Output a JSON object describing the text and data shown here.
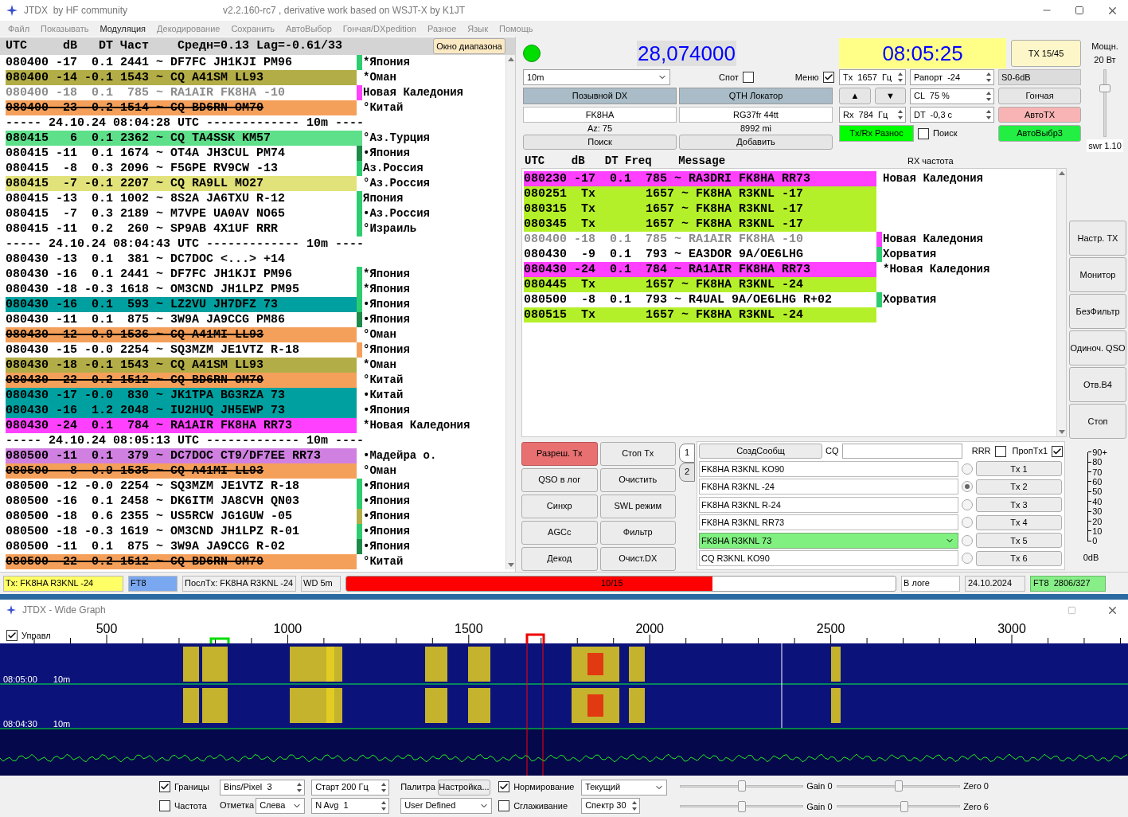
{
  "window": {
    "title": "JTDX  by HF community",
    "version": "v2.2.160-rc7 , derivative work based on WSJT-X by K1JT"
  },
  "menu": [
    {
      "label": "Файл",
      "selected": false
    },
    {
      "label": "Показывать",
      "selected": false
    },
    {
      "label": "Модуляция",
      "selected": true
    },
    {
      "label": "Декодирование",
      "selected": false
    },
    {
      "label": "Сохранить",
      "selected": false
    },
    {
      "label": "АвтоВыбор",
      "selected": false
    },
    {
      "label": "Гончая/DXpedition",
      "selected": false
    },
    {
      "label": "Разное",
      "selected": false
    },
    {
      "label": "Язык",
      "selected": false
    },
    {
      "label": "Помощь",
      "selected": false
    }
  ],
  "band_activity": {
    "header": "UTC     dB   DT Част    Средн=0.13 Lag=-0.61/33",
    "band_window_button": "Окно диапазона",
    "rows": [
      {
        "kind": "decode",
        "text": "080400 -17  0.1 2441 ~ DF7FC JH1KJI PM96",
        "color": "#ffffff",
        "faded": false,
        "struck": false,
        "country": {
          "name": "*Япония",
          "color": "#2ecc71"
        }
      },
      {
        "kind": "decode",
        "text": "080400 -14 -0.1 1543 ~ CQ A41SM LL93",
        "color": "#b3ad47",
        "faded": false,
        "struck": false,
        "country": {
          "name": "*Оман"
        }
      },
      {
        "kind": "decode",
        "text": "080400 -18  0.1  785 ~ RA1AIR FK8HA -10",
        "color": "#ffffff",
        "faded": true,
        "struck": false,
        "country": {
          "name": "Новая Каледония",
          "color": "#ff40ff"
        }
      },
      {
        "kind": "decode",
        "text": "080400 -23  0.2 1514 ~ CQ BD6RN OM70",
        "color": "#f5a05a",
        "faded": false,
        "struck": true,
        "country": {
          "name": "°Китай"
        }
      },
      {
        "kind": "separator",
        "text": "----- 24.10.24 08:04:28 UTC ------------- 10m ----"
      },
      {
        "kind": "decode",
        "text": "080415   6  0.1 2362 ~ CQ TA4SSK KM57",
        "color": "#5ee08a",
        "faded": false,
        "struck": false,
        "country": {
          "name": "°Аз.Турция",
          "color": "#5ee08a"
        }
      },
      {
        "kind": "decode",
        "text": "080415 -11  0.1 1674 ~ OT4A JH3CUL PM74",
        "color": "#ffffff",
        "faded": false,
        "struck": false,
        "country": {
          "name": "•Япония",
          "color": "#1e8a4a"
        }
      },
      {
        "kind": "decode",
        "text": "080415  -8  0.3 2096 ~ F5GPE RV9CW -13",
        "color": "#ffffff",
        "faded": false,
        "struck": false,
        "country": {
          "name": "Аз.Россия",
          "color": "#2ecc71"
        }
      },
      {
        "kind": "decode",
        "text": "080415  -7 -0.1 2207 ~ CQ RA9LL MO27",
        "color": "#e2e27a",
        "faded": false,
        "struck": false,
        "country": {
          "name": "°Аз.Россия"
        }
      },
      {
        "kind": "decode",
        "text": "080415 -13  0.1 1002 ~ 8S2A JA6TXU R-12",
        "color": "#ffffff",
        "faded": false,
        "struck": false,
        "country": {
          "name": "Япония",
          "color": "#2ecc71"
        }
      },
      {
        "kind": "decode",
        "text": "080415  -7  0.3 2189 ~ M7VPE UA0AV NO65",
        "color": "#ffffff",
        "faded": false,
        "struck": false,
        "country": {
          "name": "•Аз.Россия",
          "color": "#2ecc71"
        }
      },
      {
        "kind": "decode",
        "text": "080415 -11  0.2  260 ~ SP9AB 4X1UF RRR",
        "color": "#ffffff",
        "faded": false,
        "struck": false,
        "country": {
          "name": "°Израиль",
          "color": "#2ecc71"
        }
      },
      {
        "kind": "separator",
        "text": "----- 24.10.24 08:04:43 UTC ------------- 10m ----"
      },
      {
        "kind": "decode",
        "text": "080430 -13  0.1  381 ~ DC7DOC <...> +14",
        "color": "#ffffff",
        "faded": false,
        "struck": false
      },
      {
        "kind": "decode",
        "text": "080430 -16  0.1 2441 ~ DF7FC JH1KJI PM96",
        "color": "#ffffff",
        "faded": false,
        "struck": false,
        "country": {
          "name": "*Япония",
          "color": "#2ecc71"
        }
      },
      {
        "kind": "decode",
        "text": "080430 -18 -0.3 1618 ~ OM3CND JH1LPZ PM95",
        "color": "#ffffff",
        "faded": false,
        "struck": false,
        "country": {
          "name": "*Япония",
          "color": "#2ecc71"
        }
      },
      {
        "kind": "decode",
        "text": "080430 -16  0.1  593 ~ LZ2VU JH7DFZ 73",
        "color": "#00a0a0",
        "faded": false,
        "struck": false,
        "country": {
          "name": "•Япония",
          "color": "#2ecc71"
        }
      },
      {
        "kind": "decode",
        "text": "080430 -11  0.1  875 ~ 3W9A JA9CCG PM86",
        "color": "#ffffff",
        "faded": false,
        "struck": false,
        "country": {
          "name": "•Япония",
          "color": "#1e8a4a"
        }
      },
      {
        "kind": "decode",
        "text": "080430 -12  0.9 1536 ~ CQ A41MI LL93",
        "color": "#f5a05a",
        "faded": false,
        "struck": true,
        "country": {
          "name": "°Оман"
        }
      },
      {
        "kind": "decode",
        "text": "080430 -15 -0.0 2254 ~ SQ3MZM JE1VTZ R-18",
        "color": "#ffffff",
        "faded": false,
        "struck": false,
        "country": {
          "name": "°Япония",
          "color": "#f5a05a"
        }
      },
      {
        "kind": "decode",
        "text": "080430 -18 -0.1 1543 ~ CQ A41SM LL93",
        "color": "#b3ad47",
        "faded": false,
        "struck": false,
        "country": {
          "name": "*Оман"
        }
      },
      {
        "kind": "decode",
        "text": "080430 -22  0.2 1512 ~ CQ BD6RN OM70",
        "color": "#f5a05a",
        "faded": false,
        "struck": true,
        "country": {
          "name": "°Китай"
        }
      },
      {
        "kind": "decode",
        "text": "080430 -17 -0.0  830 ~ JK1TPA BG3RZA 73",
        "color": "#00a0a0",
        "faded": false,
        "struck": false,
        "country": {
          "name": "•Китай"
        }
      },
      {
        "kind": "decode",
        "text": "080430 -16  1.2 2048 ~ IU2HUQ JH5EWP 73",
        "color": "#00a0a0",
        "faded": false,
        "struck": false,
        "country": {
          "name": "•Япония"
        }
      },
      {
        "kind": "decode",
        "text": "080430 -24  0.1  784 ~ RA1AIR FK8HA RR73",
        "color": "#ff40ff",
        "faded": false,
        "struck": false,
        "country": {
          "name": "*Новая Каледония"
        }
      },
      {
        "kind": "separator",
        "text": "----- 24.10.24 08:05:13 UTC ------------- 10m ----"
      },
      {
        "kind": "decode",
        "text": "080500 -11  0.1  379 ~ DC7DOC CT9/DF7EE RR73",
        "color": "#d080e0",
        "faded": false,
        "struck": false,
        "country": {
          "name": "•Мадейра о."
        }
      },
      {
        "kind": "decode",
        "text": "080500  -8  0.9 1535 ~ CQ A41MI LL93",
        "color": "#f5a05a",
        "faded": false,
        "struck": true,
        "country": {
          "name": "°Оман"
        }
      },
      {
        "kind": "decode",
        "text": "080500 -12 -0.0 2254 ~ SQ3MZM JE1VTZ R-18",
        "color": "#ffffff",
        "faded": false,
        "struck": false,
        "country": {
          "name": "•Япония",
          "color": "#2ecc71"
        }
      },
      {
        "kind": "decode",
        "text": "080500 -16  0.1 2458 ~ DK6ITM JA8CVH QN03",
        "color": "#ffffff",
        "faded": false,
        "struck": false,
        "country": {
          "name": "•Япония",
          "color": "#2ecc71"
        }
      },
      {
        "kind": "decode",
        "text": "080500 -18  0.6 2355 ~ US5RCW JG1GUW -05",
        "color": "#ffffff",
        "faded": false,
        "struck": false,
        "country": {
          "name": "•Япония",
          "color": "#b3ad47"
        }
      },
      {
        "kind": "decode",
        "text": "080500 -18 -0.3 1619 ~ OM3CND JH1LPZ R-01",
        "color": "#ffffff",
        "faded": false,
        "struck": false,
        "country": {
          "name": "•Япония",
          "color": "#2ecc71"
        }
      },
      {
        "kind": "decode",
        "text": "080500 -11  0.1  875 ~ 3W9A JA9CCG R-02",
        "color": "#ffffff",
        "faded": false,
        "struck": false,
        "country": {
          "name": "•Япония",
          "color": "#1e8a4a"
        }
      },
      {
        "kind": "decode",
        "text": "080500 -22  0.2 1512 ~ CQ BD6RN OM70",
        "color": "#f5a05a",
        "faded": false,
        "struck": true,
        "country": {
          "name": "°Китай"
        }
      }
    ]
  },
  "rx_frequency": {
    "header": "UTC    dB   DT Freq    Message",
    "label": "RX частота",
    "rows": [
      {
        "kind": "decode",
        "text": "080230 -17  0.1  785 ~ RA3DRI FK8HA RR73",
        "color": "#ff40ff",
        "faded": false,
        "struck": false,
        "country": {
          "name": "Новая Каледония"
        }
      },
      {
        "kind": "decode",
        "text": "080251  Tx       1657 ~ FK8HA R3KNL -17",
        "color": "#b4f02a",
        "faded": false,
        "struck": false
      },
      {
        "kind": "decode",
        "text": "080315  Tx       1657 ~ FK8HA R3KNL -17",
        "color": "#b4f02a",
        "faded": false,
        "struck": false
      },
      {
        "kind": "decode",
        "text": "080345  Tx       1657 ~ FK8HA R3KNL -17",
        "color": "#b4f02a",
        "faded": false,
        "struck": false
      },
      {
        "kind": "decode",
        "text": "080400 -18  0.1  785 ~ RA1AIR FK8HA -10",
        "color": "#ffffff",
        "faded": true,
        "struck": false,
        "country": {
          "name": "Новая Каледония",
          "color": "#ff40ff"
        }
      },
      {
        "kind": "decode",
        "text": "080430  -9  0.1  793 ~ EA3DOR 9A/OE6LHG",
        "color": "#ffffff",
        "faded": false,
        "struck": false,
        "country": {
          "name": "Хорватия",
          "color": "#2ecc71"
        }
      },
      {
        "kind": "decode",
        "text": "080430 -24  0.1  784 ~ RA1AIR FK8HA RR73",
        "color": "#ff40ff",
        "faded": false,
        "struck": false,
        "country": {
          "name": "*Новая Каледония"
        }
      },
      {
        "kind": "decode",
        "text": "080445  Tx       1657 ~ FK8HA R3KNL -24",
        "color": "#b4f02a",
        "faded": false,
        "struck": false
      },
      {
        "kind": "decode",
        "text": "080500  -8  0.1  793 ~ R4UAL 9A/OE6LHG R+02",
        "color": "#ffffff",
        "faded": false,
        "struck": false,
        "country": {
          "name": "Хорватия",
          "color": "#2ecc71"
        }
      },
      {
        "kind": "decode",
        "text": "080515  Tx       1657 ~ FK8HA R3KNL -24",
        "color": "#b4f02a",
        "faded": false,
        "struck": false
      }
    ]
  },
  "controls": {
    "frequency": "28,074000",
    "time": "08:05:25",
    "tx_period_button": "TX 15/45",
    "power": {
      "label": "Мощн.",
      "value": "20 Вт",
      "level": 0.72
    },
    "swr": "swr 1.10",
    "band": "10m",
    "spot": {
      "label": "Спот",
      "checked": false
    },
    "menu_toggle": {
      "label": "Меню",
      "checked": true
    },
    "tx_freq": "Tx  1657  Гц",
    "report": "Рапорт  -24",
    "s_meter": "S0-6dB",
    "dx_call_header": "Позывной DX",
    "dx_grid_header": "QTH Локатор",
    "dx_call": "FK8HA",
    "dx_grid": "RG37fr 44tt",
    "azimuth": "Az: 75",
    "distance": "8992 mi",
    "lookup_button": "Поиск",
    "add_button": "Добавить",
    "up_button": "▲",
    "down_button": "▼",
    "cl": "CL  75 %",
    "hound_button": "Гончая",
    "rx_freq": "Rx  784  Гц",
    "dt": "DT  -0,3 с",
    "auto_tx": {
      "label": "АвтоTX",
      "on": true,
      "color": "#f8b4b4"
    },
    "split": {
      "label": "Tx/Rx Разнос",
      "on": true,
      "color": "#00ff00"
    },
    "search": {
      "label": "Поиск",
      "checked": false
    },
    "auto_select": {
      "label": "АвтоВыбр3",
      "on": true,
      "color": "#22ee44"
    }
  },
  "side_buttons": [
    "Настр. TX",
    "Монитор",
    "БезФильтр",
    "Одиноч. QSO",
    "Отв.B4",
    "Стоп"
  ],
  "action_buttons": [
    {
      "label": "Разреш. Tx",
      "on": true
    },
    {
      "label": "Стоп Tx",
      "on": false
    },
    {
      "label": "QSO в лог",
      "on": false
    },
    {
      "label": "Очистить",
      "on": false
    },
    {
      "label": "Синхр",
      "on": false
    },
    {
      "label": "SWL режим",
      "on": false
    },
    {
      "label": "AGCc",
      "on": false
    },
    {
      "label": "Фильтр",
      "on": false
    },
    {
      "label": "Декод",
      "on": false
    },
    {
      "label": "Очист.DX",
      "on": false
    }
  ],
  "message_tabs": [
    {
      "label": "1",
      "selected": true
    },
    {
      "label": "2",
      "selected": false
    }
  ],
  "messages": {
    "generate_button": "СоздСообщ",
    "cq_label": "CQ",
    "rrr": {
      "label": "RRR",
      "checked": false
    },
    "skip_tx1": {
      "label": "ПропTx1",
      "checked": true
    },
    "rows": [
      {
        "kind": "field",
        "text": "FK8HA R3KNL KO90",
        "selected": false,
        "button": "Tx 1"
      },
      {
        "kind": "field",
        "text": "FK8HA R3KNL -24",
        "selected": true,
        "button": "Tx 2"
      },
      {
        "kind": "field",
        "text": "FK8HA R3KNL R-24",
        "selected": false,
        "button": "Tx 3"
      },
      {
        "kind": "field",
        "text": "FK8HA R3KNL RR73",
        "selected": false,
        "button": "Tx 4"
      },
      {
        "kind": "combo",
        "text": "FK8HA R3KNL 73",
        "selected": false,
        "button": "Tx 5"
      },
      {
        "kind": "field",
        "text": "CQ R3KNL KO90",
        "selected": false,
        "button": "Tx 6"
      }
    ]
  },
  "meter": {
    "ticks": [
      "90+",
      "80",
      "70",
      "60",
      "50",
      "40",
      "30",
      "20",
      "10",
      "0"
    ],
    "unit": "0dB"
  },
  "status_bar": {
    "tx_message": "Tx: FK8HA R3KNL -24",
    "mode": "FT8",
    "last_tx": "ПослTx: FK8HA R3KNL -24",
    "wd": "WD 5m",
    "progress": {
      "label": "10/15",
      "level": 0.667
    },
    "logged": "В логе",
    "date": "24.10.2024",
    "stats": "FT8  2806/327"
  },
  "wide_graph": {
    "title": "JTDX - Wide Graph",
    "control": {
      "label": "Управл",
      "checked": true
    },
    "scale": [
      "500",
      "1000",
      "1500",
      "2000",
      "2500",
      "3000"
    ],
    "waterfall_labels": [
      {
        "time": "08:05:00",
        "band": "10m"
      },
      {
        "time": "08:04:30",
        "band": "10m"
      }
    ],
    "bounds": {
      "label": "Границы",
      "checked": true
    },
    "freq_toggle": {
      "label": "Частота",
      "checked": false
    },
    "bins": "Bins/Pixel  3",
    "marker_label": "Отметка",
    "marker_side": "Слева",
    "start": "Старт 200 Гц",
    "n_avg": "N Avg  1",
    "palette_label": "Палитра",
    "palette_button": "Настройка...",
    "palette": "User Defined",
    "normalize": {
      "label": "Нормирование",
      "checked": true
    },
    "smoothing": {
      "label": "Сглаживание",
      "checked": false
    },
    "spectrum_mode": "Текущий",
    "spectrum": "Спектр 30",
    "sliders": [
      {
        "label": "Gain 0",
        "level": 0.5
      },
      {
        "label": "Zero 0",
        "level": 0.5
      },
      {
        "label": "Gain 0",
        "level": 0.5
      },
      {
        "label": "Zero 6",
        "level": 0.55
      }
    ]
  }
}
